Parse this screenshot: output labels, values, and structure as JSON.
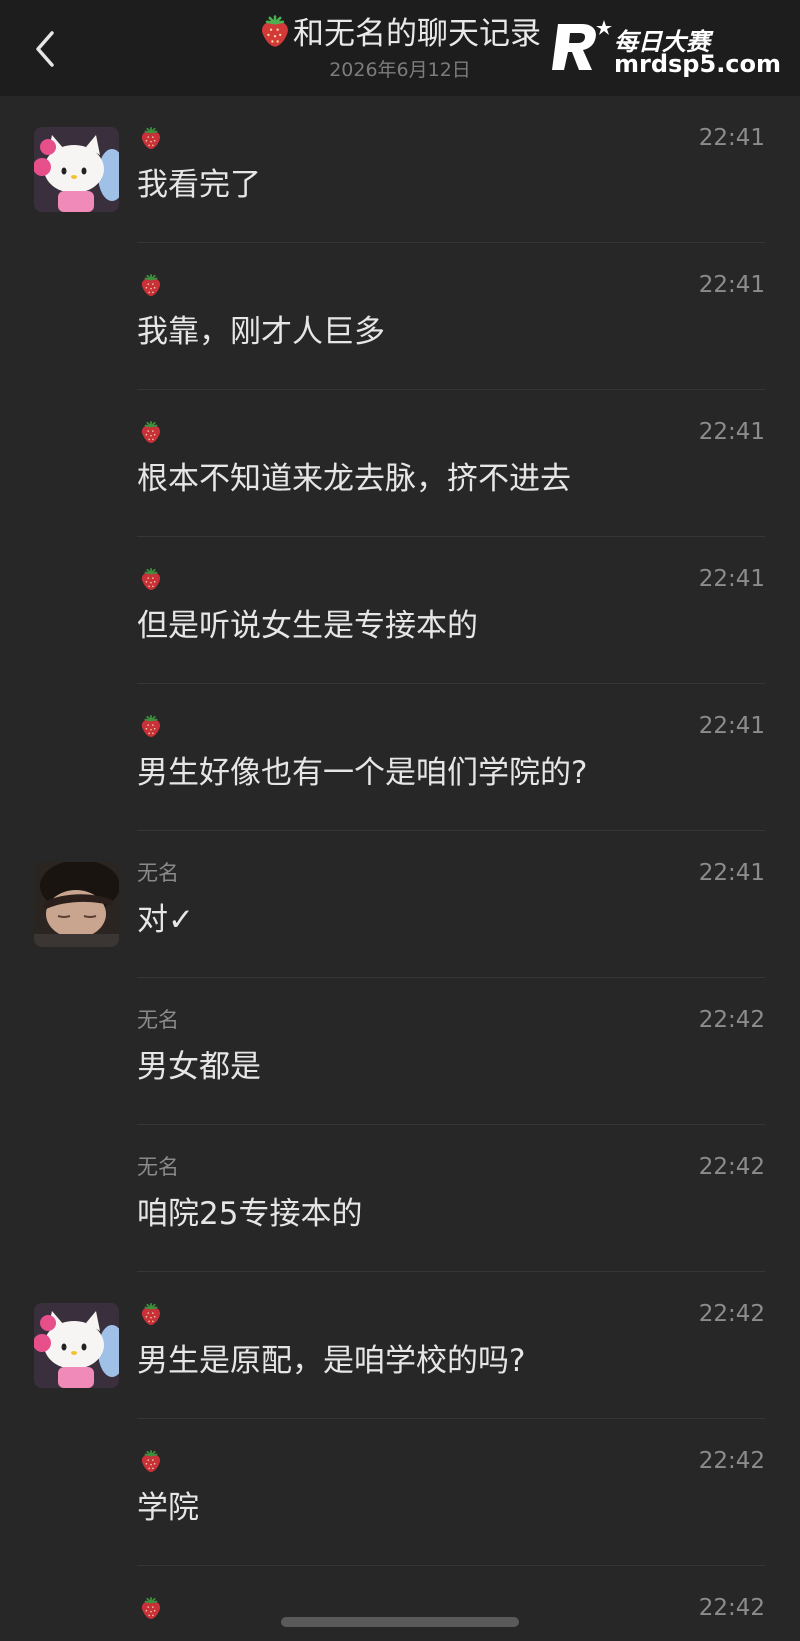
{
  "header": {
    "title": "和无名的聊天记录",
    "date": "2026年6月12日"
  },
  "watermark": {
    "brand": "每日大赛",
    "url": "mrdsp5.com"
  },
  "icons": {
    "back": "chevron-left-icon",
    "sender_mark": "strawberry-icon"
  },
  "colors": {
    "background": "#272727",
    "header_background": "#1d1d1d",
    "message_text": "#e6e6e6",
    "meta_text": "#8c8c8c",
    "strawberry": "#c8303a"
  },
  "messages": [
    {
      "sender": "",
      "avatar": "hello-kitty",
      "time": "22:41",
      "text": "我看完了"
    },
    {
      "sender": "",
      "avatar": "",
      "time": "22:41",
      "text": "我靠，刚才人巨多"
    },
    {
      "sender": "",
      "avatar": "",
      "time": "22:41",
      "text": "根本不知道来龙去脉，挤不进去"
    },
    {
      "sender": "",
      "avatar": "",
      "time": "22:41",
      "text": "但是听说女生是专接本的"
    },
    {
      "sender": "",
      "avatar": "",
      "time": "22:41",
      "text": "男生好像也有一个是咱们学院的?"
    },
    {
      "sender": "无名",
      "avatar": "person-photo",
      "time": "22:41",
      "text": "对✓"
    },
    {
      "sender": "无名",
      "avatar": "",
      "time": "22:42",
      "text": "男女都是"
    },
    {
      "sender": "无名",
      "avatar": "",
      "time": "22:42",
      "text": "咱院25专接本的"
    },
    {
      "sender": "",
      "avatar": "hello-kitty",
      "time": "22:42",
      "text": "男生是原配，是咱学校的吗?"
    },
    {
      "sender": "",
      "avatar": "",
      "time": "22:42",
      "text": "学院"
    },
    {
      "sender": "",
      "avatar": "",
      "time": "22:42",
      "text": ""
    }
  ]
}
